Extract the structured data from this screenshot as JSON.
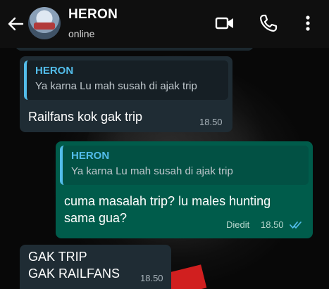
{
  "header": {
    "contact_name": "HERON",
    "status": "online",
    "icons": [
      "back-arrow-icon",
      "avatar",
      "video-call-icon",
      "voice-call-icon",
      "more-options-icon"
    ]
  },
  "messages": [
    {
      "direction": "incoming",
      "reply_to": {
        "name": "HERON",
        "text": "Ya karna Lu mah susah di ajak trip"
      },
      "text": "Railfans kok gak trip",
      "time": "18.50"
    },
    {
      "direction": "outgoing",
      "reply_to": {
        "name": "HERON",
        "text": "Ya karna Lu mah susah di ajak trip"
      },
      "text": "cuma masalah trip? lu males hunting\nsama gua?",
      "status_label": "Diedit",
      "time": "18.50",
      "read": true
    },
    {
      "direction": "incoming",
      "text": "GAK TRIP\nGAK RAILFANS",
      "time": "18.50"
    }
  ],
  "colors": {
    "incoming_bubble": "#1f2c34",
    "outgoing_bubble": "#005c4b",
    "quote_accent": "#53bdeb",
    "read_ticks": "#53bdeb"
  }
}
